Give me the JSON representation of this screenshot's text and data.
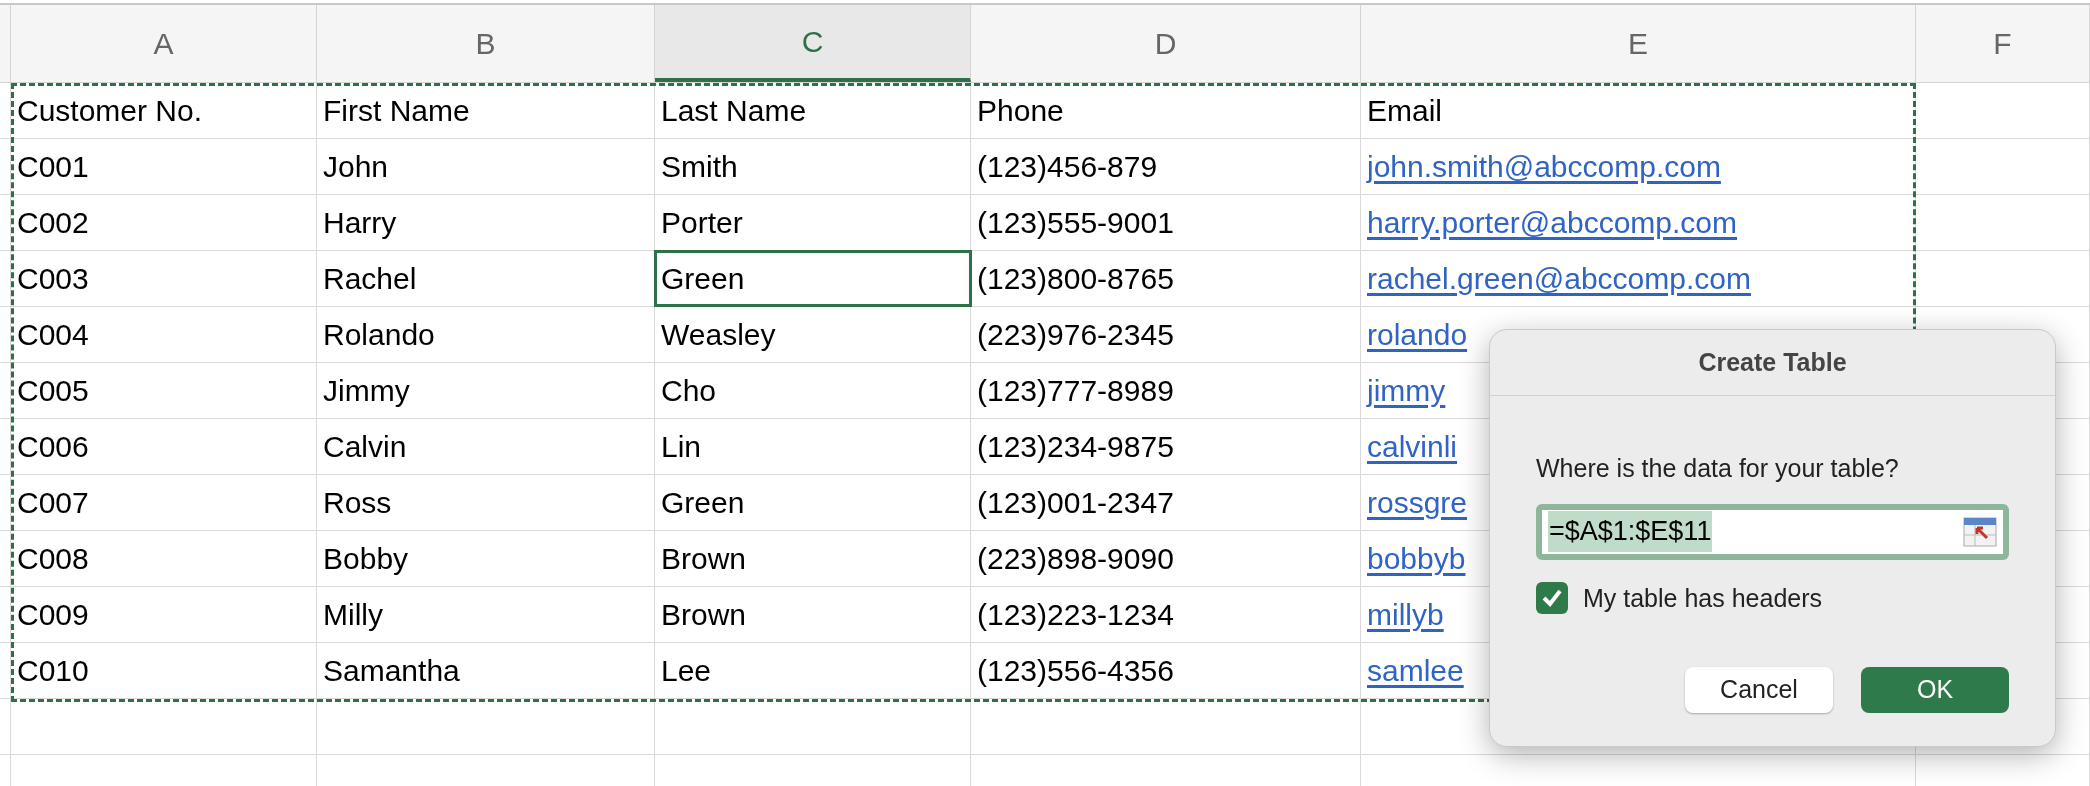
{
  "columns": [
    {
      "label": "A",
      "selected": false
    },
    {
      "label": "B",
      "selected": false
    },
    {
      "label": "C",
      "selected": true
    },
    {
      "label": "D",
      "selected": false
    },
    {
      "label": "E",
      "selected": false
    },
    {
      "label": "F",
      "selected": false
    }
  ],
  "rows": [
    {
      "cells": [
        {
          "text": "Customer No.",
          "kind": "text",
          "selected": false
        },
        {
          "text": "First Name",
          "kind": "text",
          "selected": false
        },
        {
          "text": "Last Name",
          "kind": "text",
          "selected": false
        },
        {
          "text": "Phone",
          "kind": "text",
          "selected": false
        },
        {
          "text": "Email",
          "kind": "text",
          "selected": false
        }
      ]
    },
    {
      "cells": [
        {
          "text": "C001",
          "kind": "text",
          "selected": false
        },
        {
          "text": "John",
          "kind": "text",
          "selected": false
        },
        {
          "text": "Smith",
          "kind": "text",
          "selected": false
        },
        {
          "text": "(123)456-879",
          "kind": "text",
          "selected": false
        },
        {
          "text": "john.smith@abccomp.com",
          "kind": "link",
          "selected": false
        }
      ]
    },
    {
      "cells": [
        {
          "text": "C002",
          "kind": "text",
          "selected": false
        },
        {
          "text": "Harry",
          "kind": "text",
          "selected": false
        },
        {
          "text": "Porter",
          "kind": "text",
          "selected": false
        },
        {
          "text": "(123)555-9001",
          "kind": "text",
          "selected": false
        },
        {
          "text": "harry.porter@abccomp.com",
          "kind": "link",
          "selected": false
        }
      ]
    },
    {
      "cells": [
        {
          "text": "C003",
          "kind": "text",
          "selected": false
        },
        {
          "text": "Rachel",
          "kind": "text",
          "selected": false
        },
        {
          "text": "Green",
          "kind": "text",
          "selected": true
        },
        {
          "text": "(123)800-8765",
          "kind": "text",
          "selected": false
        },
        {
          "text": "rachel.green@abccomp.com",
          "kind": "link",
          "selected": false
        }
      ]
    },
    {
      "cells": [
        {
          "text": "C004",
          "kind": "text",
          "selected": false
        },
        {
          "text": "Rolando",
          "kind": "text",
          "selected": false
        },
        {
          "text": "Weasley",
          "kind": "text",
          "selected": false
        },
        {
          "text": "(223)976-2345",
          "kind": "text",
          "selected": false
        },
        {
          "text": "rolando",
          "kind": "link",
          "selected": false
        }
      ]
    },
    {
      "cells": [
        {
          "text": "C005",
          "kind": "text",
          "selected": false
        },
        {
          "text": "Jimmy",
          "kind": "text",
          "selected": false
        },
        {
          "text": "Cho",
          "kind": "text",
          "selected": false
        },
        {
          "text": "(123)777-8989",
          "kind": "text",
          "selected": false
        },
        {
          "text": "jimmy",
          "kind": "link",
          "selected": false
        }
      ]
    },
    {
      "cells": [
        {
          "text": "C006",
          "kind": "text",
          "selected": false
        },
        {
          "text": "Calvin",
          "kind": "text",
          "selected": false
        },
        {
          "text": "Lin",
          "kind": "text",
          "selected": false
        },
        {
          "text": "(123)234-9875",
          "kind": "text",
          "selected": false
        },
        {
          "text": "calvinli",
          "kind": "link",
          "selected": false
        }
      ]
    },
    {
      "cells": [
        {
          "text": "C007",
          "kind": "text",
          "selected": false
        },
        {
          "text": "Ross",
          "kind": "text",
          "selected": false
        },
        {
          "text": "Green",
          "kind": "text",
          "selected": false
        },
        {
          "text": "(123)001-2347",
          "kind": "text",
          "selected": false
        },
        {
          "text": "rossgre",
          "kind": "link",
          "selected": false
        }
      ]
    },
    {
      "cells": [
        {
          "text": "C008",
          "kind": "text",
          "selected": false
        },
        {
          "text": "Bobby",
          "kind": "text",
          "selected": false
        },
        {
          "text": "Brown",
          "kind": "text",
          "selected": false
        },
        {
          "text": "(223)898-9090",
          "kind": "text",
          "selected": false
        },
        {
          "text": "bobbyb",
          "kind": "link",
          "selected": false
        }
      ]
    },
    {
      "cells": [
        {
          "text": "C009",
          "kind": "text",
          "selected": false
        },
        {
          "text": "Milly",
          "kind": "text",
          "selected": false
        },
        {
          "text": "Brown",
          "kind": "text",
          "selected": false
        },
        {
          "text": "(123)223-1234",
          "kind": "text",
          "selected": false
        },
        {
          "text": "millyb",
          "kind": "link",
          "selected": false
        }
      ]
    },
    {
      "cells": [
        {
          "text": "C010",
          "kind": "text",
          "selected": false
        },
        {
          "text": "Samantha",
          "kind": "text",
          "selected": false
        },
        {
          "text": "Lee",
          "kind": "text",
          "selected": false
        },
        {
          "text": "(123)556-4356",
          "kind": "text",
          "selected": false
        },
        {
          "text": "samlee",
          "kind": "link",
          "selected": false
        }
      ]
    }
  ],
  "dialog": {
    "title": "Create Table",
    "prompt": "Where is the data for your table?",
    "range": "=$A$1:$E$11",
    "has_headers": {
      "label": "My table has headers",
      "checked": true
    },
    "buttons": [
      {
        "label": "Cancel",
        "kind": "secondary"
      },
      {
        "label": "OK",
        "kind": "primary"
      }
    ]
  }
}
